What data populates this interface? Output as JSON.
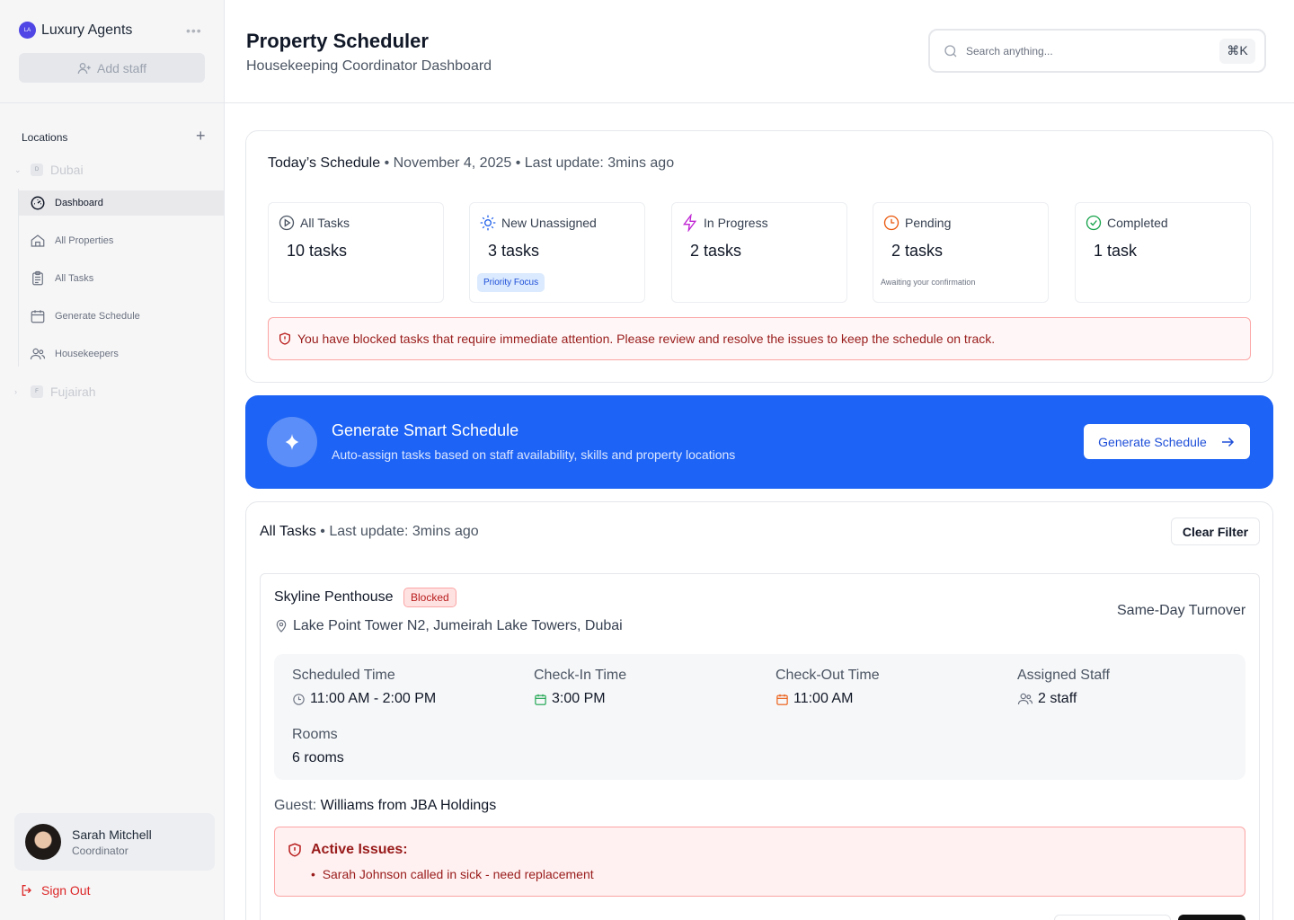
{
  "sidebar": {
    "brand_initials": "LA",
    "brand_name": "Luxury Agents",
    "add_staff_label": "Add staff",
    "locations_label": "Locations",
    "locations": [
      {
        "initial": "D",
        "name": "Dubai"
      },
      {
        "initial": "F",
        "name": "Fujairah"
      }
    ],
    "nav": [
      {
        "label": "Dashboard",
        "icon": "dashboard-icon"
      },
      {
        "label": "All Properties",
        "icon": "home-icon"
      },
      {
        "label": "All Tasks",
        "icon": "clipboard-icon"
      },
      {
        "label": "Generate Schedule",
        "icon": "calendar-icon"
      },
      {
        "label": "Housekeepers",
        "icon": "users-icon"
      }
    ],
    "user": {
      "name": "Sarah Mitchell",
      "role": "Coordinator"
    },
    "sign_out_label": "Sign Out"
  },
  "header": {
    "title": "Property Scheduler",
    "subtitle": "Housekeeping Coordinator Dashboard",
    "search_placeholder": "Search anything...",
    "search_shortcut": "⌘K"
  },
  "schedule": {
    "title": "Today’s Schedule",
    "date": "• November 4, 2025",
    "last_update": "• Last update: 3mins ago",
    "stats": [
      {
        "label": "All Tasks",
        "value": "10 tasks",
        "icon": "play-circle-icon"
      },
      {
        "label": "New Unassigned",
        "value": "3 tasks",
        "icon": "sun-icon",
        "tag": "Priority Focus"
      },
      {
        "label": "In Progress",
        "value": "2 tasks",
        "icon": "lightning-icon"
      },
      {
        "label": "Pending",
        "value": "2 tasks",
        "icon": "clock-icon",
        "note": "Awaiting your confirmation"
      },
      {
        "label": "Completed",
        "value": "1 task",
        "icon": "check-circle-icon"
      }
    ],
    "alert": "You have blocked tasks that require immediate attention. Please review and resolve the issues to keep the schedule on track."
  },
  "smart": {
    "title": "Generate Smart Schedule",
    "subtitle": "Auto-assign tasks based on staff availability, skills and property locations",
    "button": "Generate Schedule"
  },
  "tasks": {
    "title": "All Tasks",
    "last_update": "• Last update: 3mins ago",
    "clear_filter": "Clear Filter",
    "items": [
      {
        "property": "Skyline Penthouse",
        "status": "Blocked",
        "type": "Same-Day Turnover",
        "address": "Lake Point Tower N2, Jumeirah Lake Towers, Dubai",
        "scheduled_label": "Scheduled Time",
        "scheduled": "11:00 AM - 2:00 PM",
        "checkin_label": "Check-In Time",
        "checkin": "3:00 PM",
        "checkout_label": "Check-Out Time",
        "checkout": "11:00 AM",
        "staff_label": "Assigned Staff",
        "staff": "2 staff",
        "rooms_label": "Rooms",
        "rooms": "6 rooms",
        "guest_label": "Guest:",
        "guest": "Williams from JBA Holdings",
        "issues_title": "Active Issues:",
        "issues": [
          "Sarah Johnson called in sick - need replacement"
        ]
      }
    ]
  },
  "colors": {
    "accent": "#1d63f5",
    "danger": "#991b1b",
    "danger_bg": "#fff1f1"
  }
}
